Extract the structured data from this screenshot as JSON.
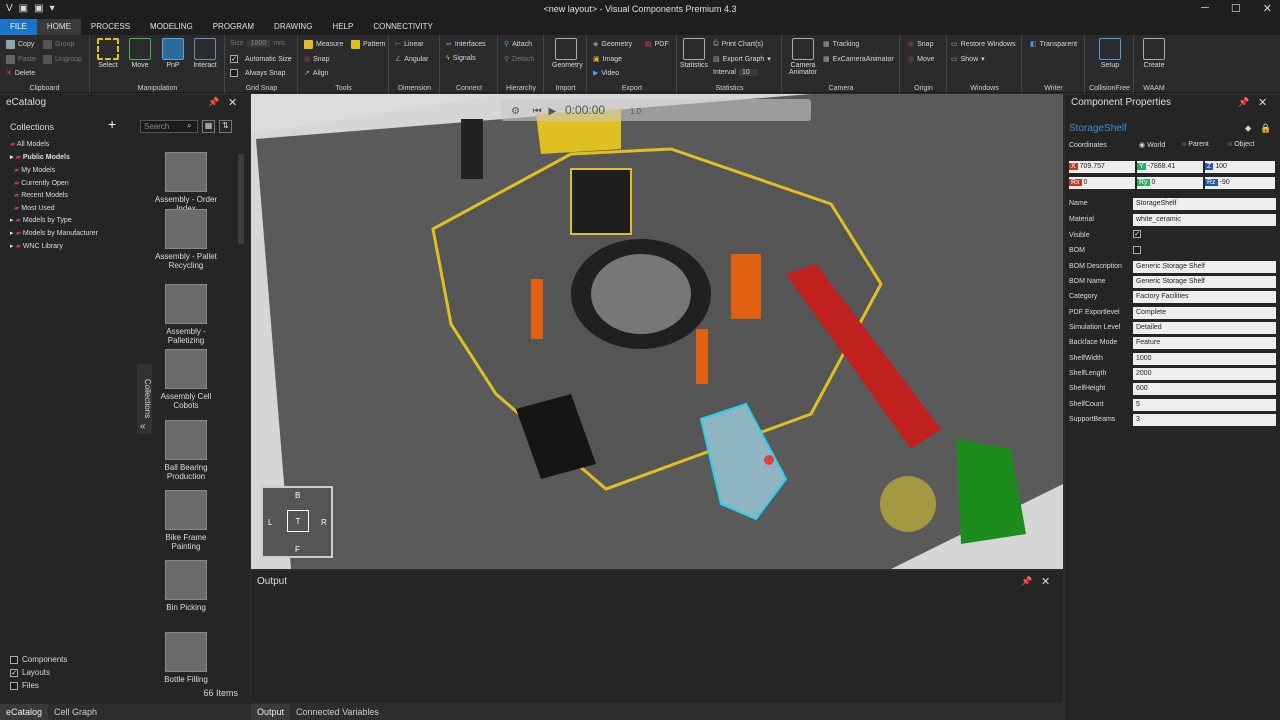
{
  "app": {
    "title": "<new layout> - Visual Components Premium 4.3"
  },
  "menu": {
    "tabs": [
      "FILE",
      "HOME",
      "PROCESS",
      "MODELING",
      "PROGRAM",
      "DRAWING",
      "HELP",
      "CONNECTIVITY"
    ]
  },
  "ribbon": {
    "clipboard": {
      "copy": "Copy",
      "paste": "Paste",
      "delete": "Delete",
      "group": "Group",
      "ungroup": "Ungroup",
      "label": "Clipboard"
    },
    "manipulation": {
      "select": "Select",
      "move": "Move",
      "pnp": "PnP",
      "interact": "Interact",
      "label": "Manipulation"
    },
    "grid_snap": {
      "size_placeholder": "Size",
      "size_value": "1000",
      "unit": "mm",
      "automatic_size": "Automatic Size",
      "always_snap": "Always Snap",
      "label": "Grid Snap"
    },
    "tools": {
      "measure": "Measure",
      "pattern": "Pattern",
      "snap": "Snap",
      "align": "Align",
      "label": "Tools"
    },
    "dimension": {
      "linear": "Linear",
      "angular": "Angular",
      "label": "Dimension"
    },
    "connect": {
      "interfaces": "Interfaces",
      "signals": "Signals",
      "label": "Connect"
    },
    "hierarchy": {
      "attach": "Attach",
      "detach": "Detach",
      "label": "Hierarchy"
    },
    "import": {
      "geometry": "Geometry",
      "label": "Import"
    },
    "export": {
      "geometry": "Geometry",
      "pdf": "PDF",
      "image": "Image",
      "video": "Video",
      "label": "Export"
    },
    "statistics": {
      "statistics": "Statistics",
      "print_charts": "Print Chart(s)",
      "export_graph": "Export Graph",
      "interval": "Interval",
      "interval_value": "10",
      "label": "Statistics"
    },
    "camera": {
      "camera_animator": "Camera Animator",
      "tracking": "Tracking",
      "excamera": "ExCameraAnimator",
      "label": "Camera"
    },
    "origin": {
      "snap": "Snap",
      "move": "Move",
      "label": "Origin"
    },
    "windows": {
      "restore": "Restore Windows",
      "show": "Show",
      "label": "Windows"
    },
    "writer": {
      "transparent": "Transparent",
      "label": "Writer"
    },
    "collisionfree": {
      "setup": "Setup",
      "label": "CollisionFree"
    },
    "waam": {
      "create": "Create",
      "label": "WAAM"
    }
  },
  "ecatalog": {
    "title": "eCatalog",
    "collections_label": "Collections",
    "search_placeholder": "Search",
    "tree": [
      "All Models",
      "Public Models",
      "My Models",
      "Currently Open",
      "Recent Models",
      "Most Used",
      "Models by Type",
      "Models by Manufacturer",
      "WNC Library"
    ],
    "items": [
      "Assembly - Order Index",
      "Assembly - Pallet Recycling",
      "Assembly - Palletizing",
      "Assembly Cell Cobots",
      "Ball Bearing Production",
      "Bike Frame Painting",
      "Bin Picking",
      "Bottle Filling"
    ],
    "count": "66 Items",
    "side_tab": "Collections",
    "filters": [
      {
        "label": "Components",
        "checked": false
      },
      {
        "label": "Layouts",
        "checked": true
      },
      {
        "label": "Files",
        "checked": false
      }
    ]
  },
  "viewport": {
    "time": "0:00:00",
    "speed": "1.0",
    "cube": {
      "b": "B",
      "l": "L",
      "t": "T",
      "r": "R",
      "f": "F"
    }
  },
  "output": {
    "title": "Output"
  },
  "bottom_tabs_left": [
    "eCatalog",
    "Cell Graph"
  ],
  "bottom_tabs_center": [
    "Output",
    "Connected Variables"
  ],
  "properties": {
    "title": "Component Properties",
    "component": "StorageShelf",
    "coordinates": "Coordinates",
    "coord_opts": [
      "World",
      "Parent",
      "Object"
    ],
    "x": "709.757",
    "y": "-7868.41",
    "z": "100",
    "rx": "0",
    "ry": "0",
    "rz": "-90",
    "rows": [
      {
        "label": "Name",
        "value": "StorageShelf"
      },
      {
        "label": "Material",
        "value": "white_ceramic"
      },
      {
        "label": "Visible",
        "value": "✓"
      },
      {
        "label": "BOM",
        "value": ""
      },
      {
        "label": "BOM Description",
        "value": "Generic Storage Shelf"
      },
      {
        "label": "BOM Name",
        "value": "Generic Storage Shelf"
      },
      {
        "label": "Category",
        "value": "Factory Facilities"
      },
      {
        "label": "PDF Exportlevel",
        "value": "Complete"
      },
      {
        "label": "Simulation Level",
        "value": "Detailed"
      },
      {
        "label": "Backface Mode",
        "value": "Feature"
      },
      {
        "label": "ShelfWidth",
        "value": "1000"
      },
      {
        "label": "ShelfLength",
        "value": "2000"
      },
      {
        "label": "ShelfHeight",
        "value": "600"
      },
      {
        "label": "ShelfCount",
        "value": "5"
      },
      {
        "label": "SupportBeams",
        "value": "3"
      }
    ]
  },
  "colors": {
    "accent": "#1b74c9",
    "panel": "#252526",
    "highlight": "#2aa0e0"
  }
}
